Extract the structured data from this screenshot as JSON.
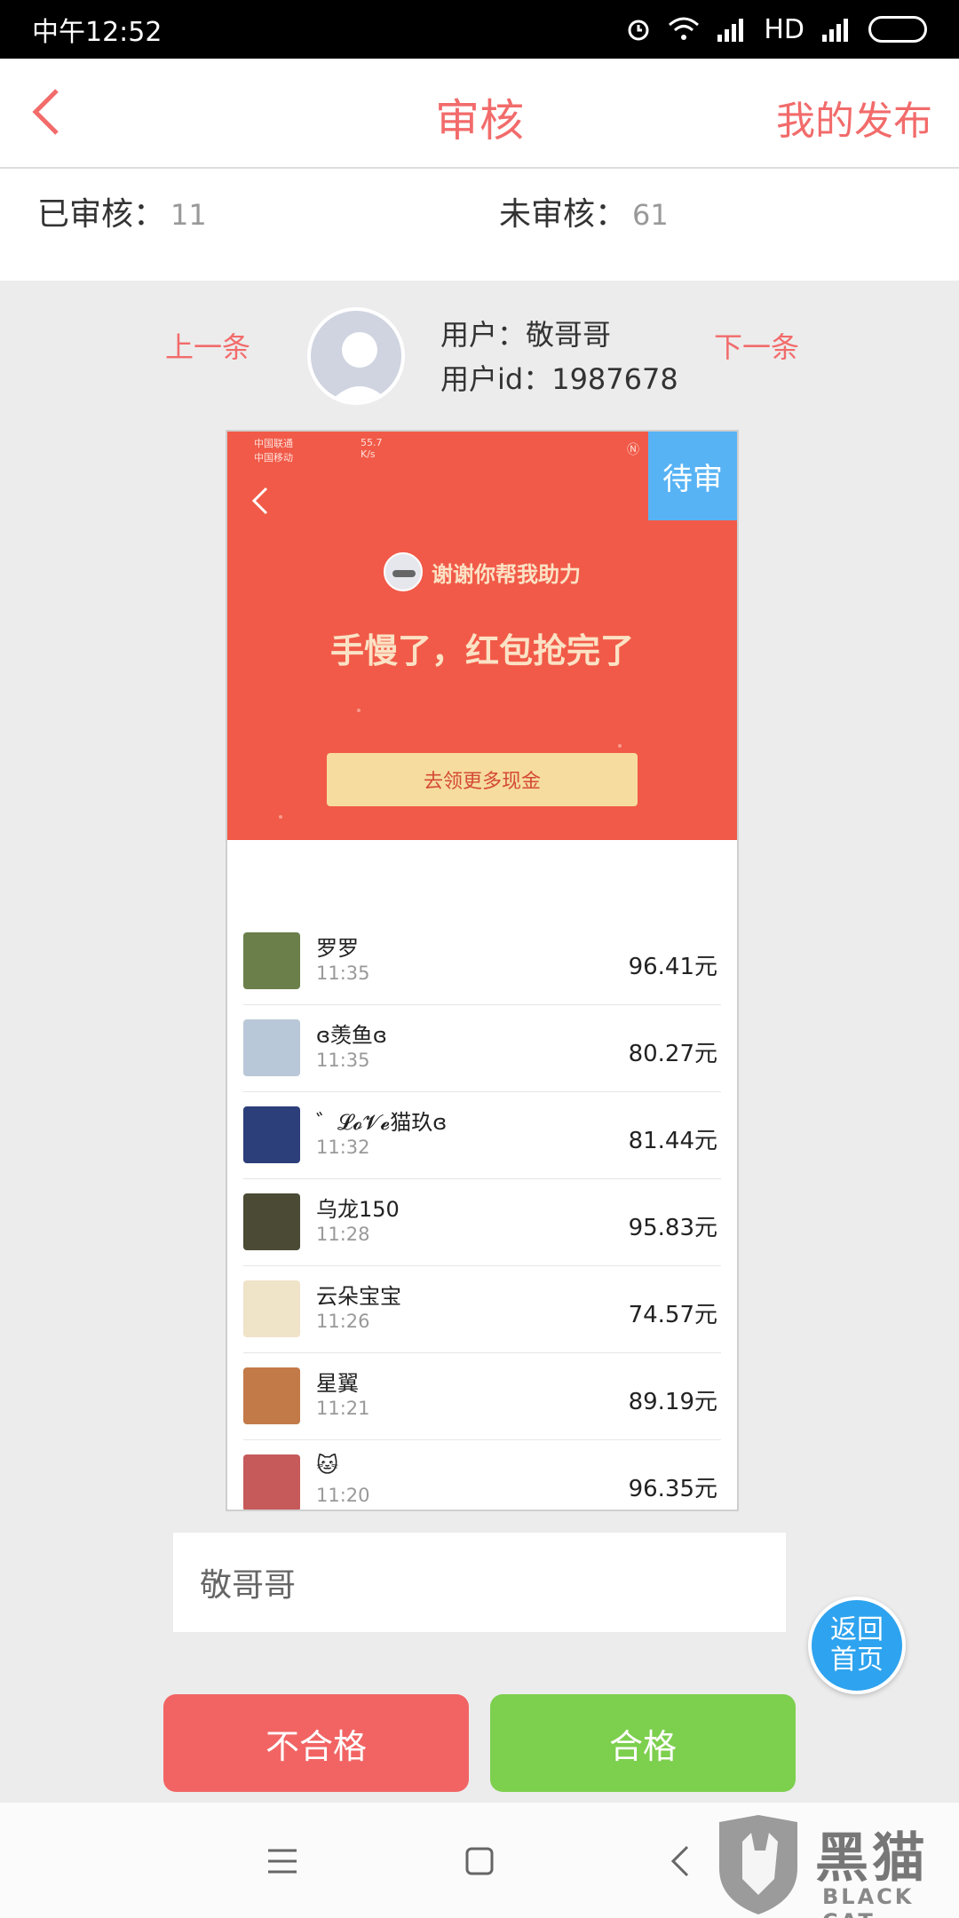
{
  "status_bar": {
    "time": "中午12:52",
    "network": "HD"
  },
  "nav": {
    "title": "审核",
    "right_link": "我的发布"
  },
  "counts": {
    "reviewed_label": "已审核：",
    "reviewed": "11",
    "unreviewed_label": "未审核：",
    "unreviewed": "61"
  },
  "user": {
    "prev": "上一条",
    "next": "下一条",
    "name_line": "用户：敬哥哥",
    "id_line": "用户id：1987678"
  },
  "screenshot": {
    "carrier1": "中国联通",
    "carrier2": "中国移动",
    "speed": "55.7",
    "speed_unit": "K/s",
    "badge": "待审",
    "thanks": "谢谢你帮我助力",
    "headline": "手慢了，红包抢完了",
    "cash_button": "去领更多现金",
    "rows": [
      {
        "name": "罗罗",
        "time": "11:35",
        "amount": "96.41元",
        "color": "#6b7f4a"
      },
      {
        "name": "ɞ羡鱼ɞ",
        "time": "11:35",
        "amount": "80.27元",
        "color": "#b9c8d8"
      },
      {
        "name": "゛𝓛𝓸𝓥𝓮猫玖ɞ",
        "time": "11:32",
        "amount": "81.44元",
        "color": "#2c3f7a"
      },
      {
        "name": "乌龙150",
        "time": "11:28",
        "amount": "95.83元",
        "color": "#4b4a34"
      },
      {
        "name": "云朵宝宝",
        "time": "11:26",
        "amount": "74.57元",
        "color": "#efe3c8"
      },
      {
        "name": "星翼",
        "time": "11:21",
        "amount": "89.19元",
        "color": "#c27a48"
      },
      {
        "name": "🐱",
        "time": "11:20",
        "amount": "96.35元",
        "color": "#c65a5a"
      }
    ]
  },
  "comment": {
    "value": "敬哥哥"
  },
  "fab": {
    "line1": "返回",
    "line2": "首页"
  },
  "actions": {
    "fail": "不合格",
    "pass": "合格"
  },
  "watermark": {
    "cn": "黑猫",
    "en": "BLACK CAT"
  },
  "colors": {
    "accent": "#f26b6b",
    "pending": "#58b3f5",
    "pass": "#7dcf4e",
    "fail": "#f26464"
  }
}
